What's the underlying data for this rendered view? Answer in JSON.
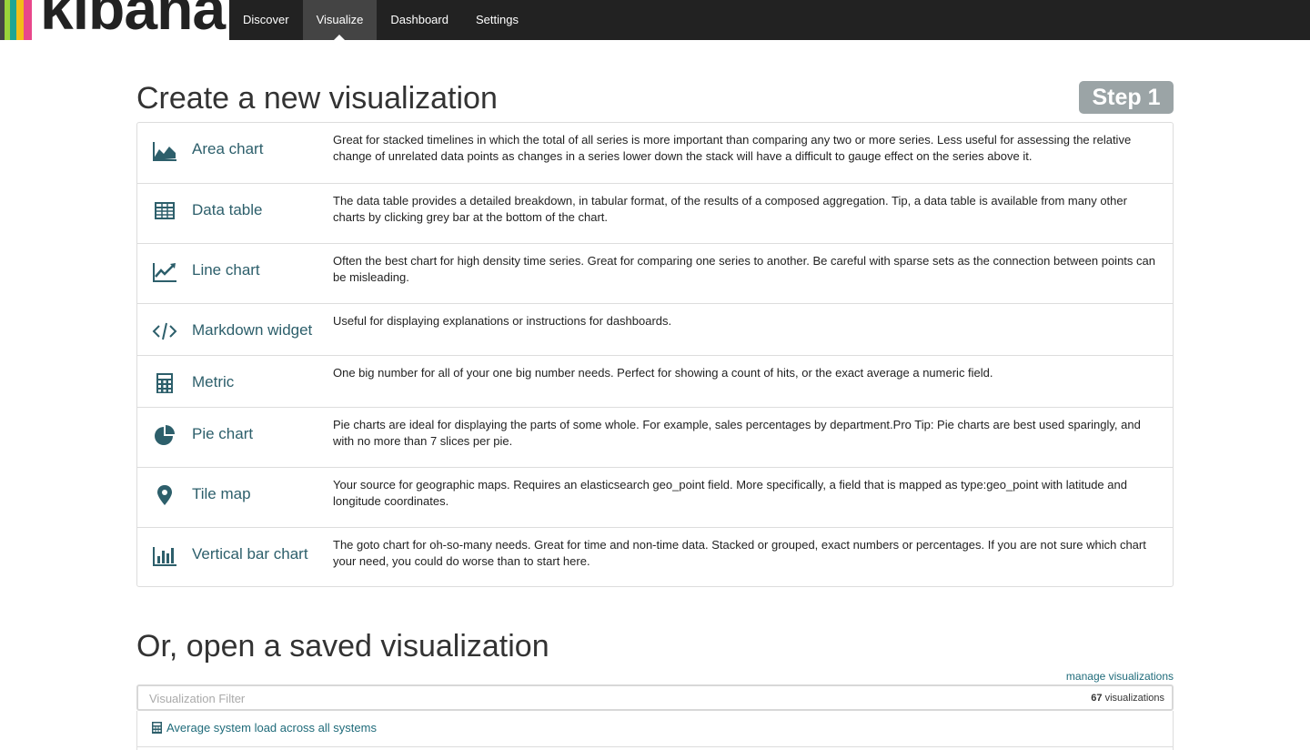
{
  "app": {
    "logo_text": "kibana",
    "logo_stripes": [
      "#e8478b",
      "#f3bd19",
      "#1ea593",
      "#444444"
    ]
  },
  "nav": {
    "tabs": [
      {
        "label": "Discover",
        "active": false
      },
      {
        "label": "Visualize",
        "active": true
      },
      {
        "label": "Dashboard",
        "active": false
      },
      {
        "label": "Settings",
        "active": false
      }
    ]
  },
  "create": {
    "title": "Create a new visualization",
    "step_label": "Step 1",
    "types": [
      {
        "icon": "area-chart-icon",
        "name": "Area chart",
        "description": "Great for stacked timelines in which the total of all series is more important than comparing any two or more series. Less useful for assessing the relative change of unrelated data points as changes in a series lower down the stack will have a difficult to gauge effect on the series above it."
      },
      {
        "icon": "table-icon",
        "name": "Data table",
        "description": "The data table provides a detailed breakdown, in tabular format, of the results of a composed aggregation. Tip, a data table is available from many other charts by clicking grey bar at the bottom of the chart."
      },
      {
        "icon": "line-chart-icon",
        "name": "Line chart",
        "description": "Often the best chart for high density time series. Great for comparing one series to another. Be careful with sparse sets as the connection between points can be misleading."
      },
      {
        "icon": "code-icon",
        "name": "Markdown widget",
        "description": "Useful for displaying explanations or instructions for dashboards."
      },
      {
        "icon": "calculator-icon",
        "name": "Metric",
        "description": "One big number for all of your one big number needs. Perfect for showing a count of hits, or the exact average a numeric field."
      },
      {
        "icon": "pie-chart-icon",
        "name": "Pie chart",
        "description": "Pie charts are ideal for displaying the parts of some whole. For example, sales percentages by department.Pro Tip: Pie charts are best used sparingly, and with no more than 7 slices per pie."
      },
      {
        "icon": "map-marker-icon",
        "name": "Tile map",
        "description": "Your source for geographic maps. Requires an elasticsearch geo_point field. More specifically, a field that is mapped as type:geo_point with latitude and longitude coordinates."
      },
      {
        "icon": "bar-chart-icon",
        "name": "Vertical bar chart",
        "description": "The goto chart for oh-so-many needs. Great for time and non-time data. Stacked or grouped, exact numbers or percentages. If you are not sure which chart your need, you could do worse than to start here."
      }
    ]
  },
  "saved": {
    "title": "Or, open a saved visualization",
    "manage_link": "manage visualizations",
    "filter_placeholder": "Visualization Filter",
    "count": "67",
    "count_suffix": "visualizations",
    "items": [
      {
        "icon": "calculator-icon",
        "label": "Average system load across all systems"
      }
    ]
  },
  "colors": {
    "accent": "#2d5f6b",
    "link": "#1f6b7a",
    "nav_bg": "#222222",
    "nav_active": "#444444",
    "step_badge": "#9ba4a6"
  }
}
